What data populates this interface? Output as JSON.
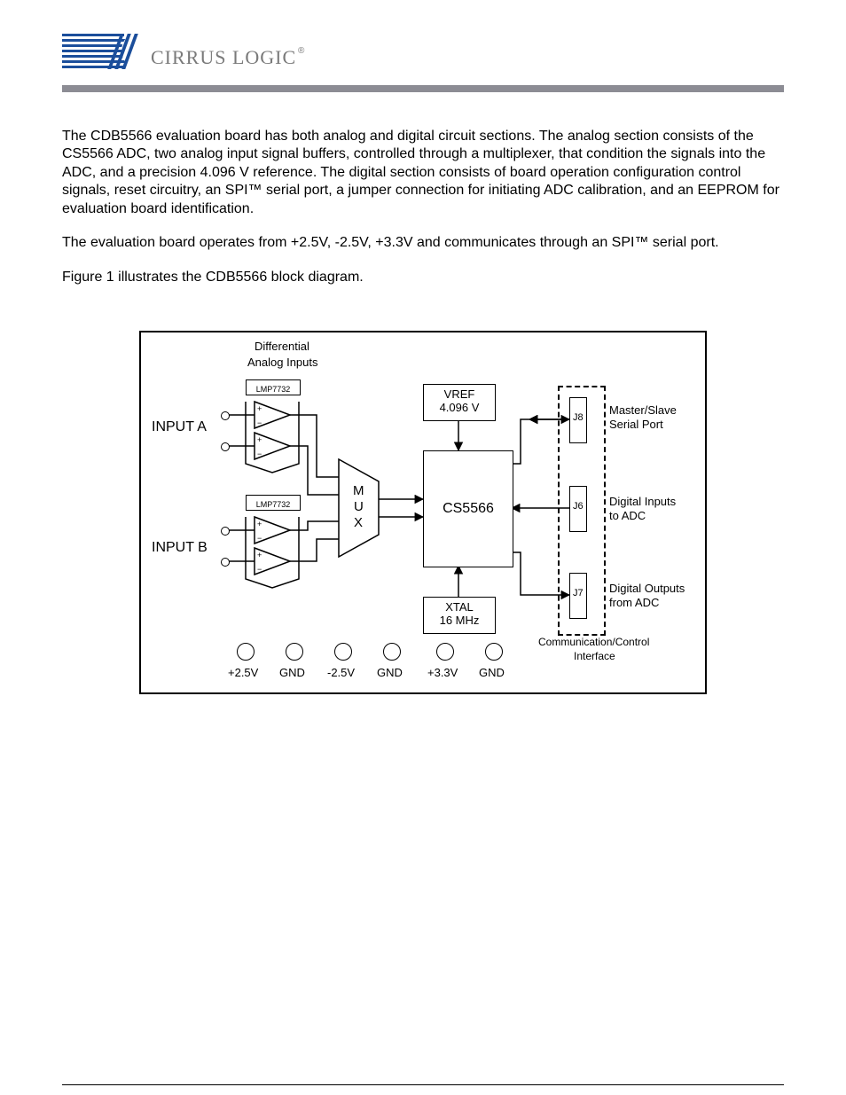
{
  "brand": "CIRRUS LOGIC",
  "paragraphs": {
    "p1": "The CDB5566 evaluation board has both analog and digital circuit sections. The analog section consists of the CS5566 ADC, two analog input signal buffers, controlled through a multiplexer, that condition the signals into the ADC, and a precision 4.096 V reference. The digital section consists of board operation configuration control signals, reset circuitry, an SPI™ serial port, a jumper connection for initiating ADC calibration, and an EEPROM for evaluation board identification.",
    "p2": "The evaluation board operates from +2.5V, -2.5V, +3.3V and communicates through an SPI™ serial port.",
    "p3": "Figure 1 illustrates the  CDB5566 block diagram."
  },
  "diagram": {
    "diff_label_1": "Differential",
    "diff_label_2": "Analog Inputs",
    "input_a": "INPUT A",
    "input_b": "INPUT B",
    "amp_label": "LMP7732",
    "mux_1": "M",
    "mux_2": "U",
    "mux_3": "X",
    "vref_1": "VREF",
    "vref_2": "4.096 V",
    "chip": "CS5566",
    "xtal_1": "XTAL",
    "xtal_2": "16 MHz",
    "j8": "J8",
    "j6": "J6",
    "j7": "J7",
    "port_j8_1": "Master/Slave",
    "port_j8_2": "Serial Port",
    "port_j6_1": "Digital Inputs",
    "port_j6_2": "to ADC",
    "port_j7_1": "Digital Outputs",
    "port_j7_2": "from ADC",
    "comm_1": "Communication/Control",
    "comm_2": "Interface",
    "pwr": [
      "+2.5V",
      "GND",
      "-2.5V",
      "GND",
      "+3.3V",
      "GND"
    ]
  }
}
